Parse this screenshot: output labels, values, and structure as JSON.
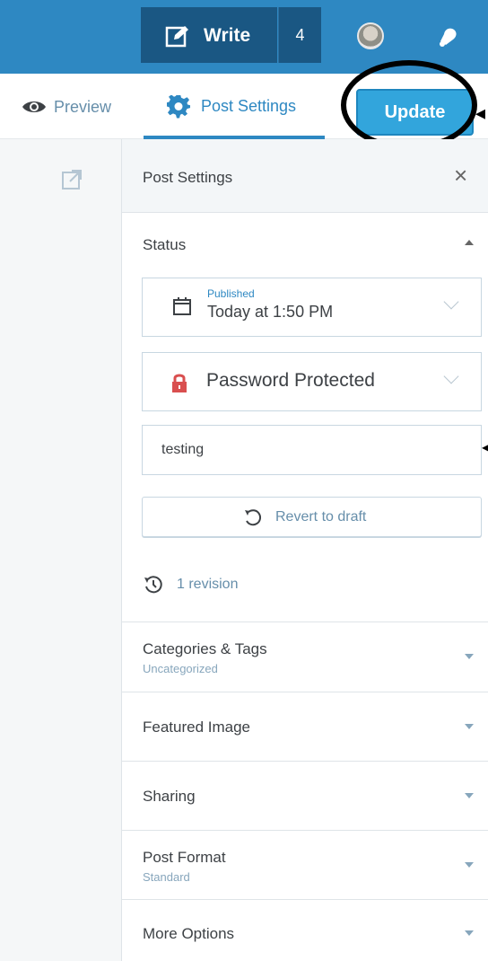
{
  "masterbar": {
    "write_label": "Write",
    "notification_count": "4",
    "icons": {
      "write": "pencil-square-icon",
      "avatar": "user-avatar",
      "notifications": "bell-icon"
    }
  },
  "toolbar": {
    "preview_label": "Preview",
    "settings_label": "Post Settings",
    "update_label": "Update",
    "icons": {
      "preview": "eye-icon",
      "settings": "gear-icon"
    }
  },
  "gutter": {
    "icons": {
      "external": "external-link-icon"
    }
  },
  "sidebar": {
    "title": "Post Settings",
    "close_glyph": "×",
    "status": {
      "title": "Status",
      "published_label": "Published",
      "published_date": "Today at 1:50 PM",
      "visibility": "Password Protected",
      "password_value": "testing",
      "revert_label": "Revert to draft",
      "revisions": "1 revision",
      "icons": {
        "calendar": "calendar-icon",
        "lock": "lock-icon",
        "revert": "undo-icon",
        "history": "history-icon"
      }
    },
    "sections": [
      {
        "title": "Categories & Tags",
        "subtitle": "Uncategorized"
      },
      {
        "title": "Featured Image"
      },
      {
        "title": "Sharing"
      },
      {
        "title": "Post Format",
        "subtitle": "Standard"
      },
      {
        "title": "More Options"
      }
    ]
  },
  "colors": {
    "masterbar": "#2e88c2",
    "accent": "#2e88c2",
    "update_button": "#32a5dc",
    "lock": "#d94f4f"
  }
}
